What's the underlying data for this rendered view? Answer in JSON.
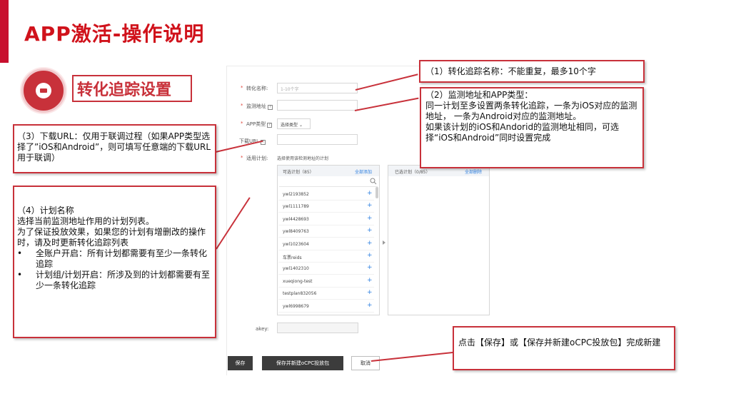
{
  "slide_title": "APP激活-操作说明",
  "section_title": "转化追踪设置",
  "icon": "message-icon",
  "accent_color": "#c8313a",
  "form": {
    "name_label": "转化名称:",
    "name_placeholder": "1-10个字",
    "monitor_url_label": "监测地址",
    "app_type_label": "APP类型",
    "app_type_value": "选择类型",
    "download_url_label": "下载URL",
    "help_mark": "?",
    "plans_label": "适用计划:",
    "plans_hint": "选择使用该检测地址的计划",
    "available_header": "可选计划（85）",
    "add_all": "全部添加",
    "selected_header": "已选计划（0/85）",
    "remove_all": "全部删除",
    "plans": [
      "ywl2193852",
      "ywl1111789",
      "ywl4428693",
      "ywl8409763",
      "ywl1023604",
      "车票reids",
      "ywl1402310",
      "xueqiong-test",
      "testplan832056",
      "ywl6998679"
    ],
    "plus": "+",
    "akey_label": "akey:",
    "save": "保存",
    "save_new": "保存并新建oCPC投放包",
    "cancel": "取消"
  },
  "callouts": {
    "c1": "（1）转化追踪名称：不能重复，最多10个字",
    "c2": [
      "（2）监测地址和APP类型：",
      "同一计划至多设置两条转化追踪，一条为iOS对应的监测地址， 一条为Android对应的监测地址。",
      "如果该计划的iOS和Andorid的监测地址相同，可选择“iOS和Android”同时设置完成"
    ],
    "c3": "（3）下载URL：仅用于联调过程（如果APP类型选择了”iOS和Android”，则可填写任意端的下载URL用于联调）",
    "c4": {
      "title": "（4）计划名称",
      "lines": [
        "选择当前监测地址作用的计划列表。",
        "为了保证投放效果，如果您的计划有增删改的操作时，请及时更新转化追踪列表"
      ],
      "bullet": "•",
      "bullets": [
        "全账户开启：所有计划都需要有至少一条转化追踪",
        "计划组/计划开启：所涉及到的计划都需要有至少一条转化追踪"
      ]
    },
    "c5": "点击【保存】或【保存并新建oCPC投放包】完成新建"
  }
}
